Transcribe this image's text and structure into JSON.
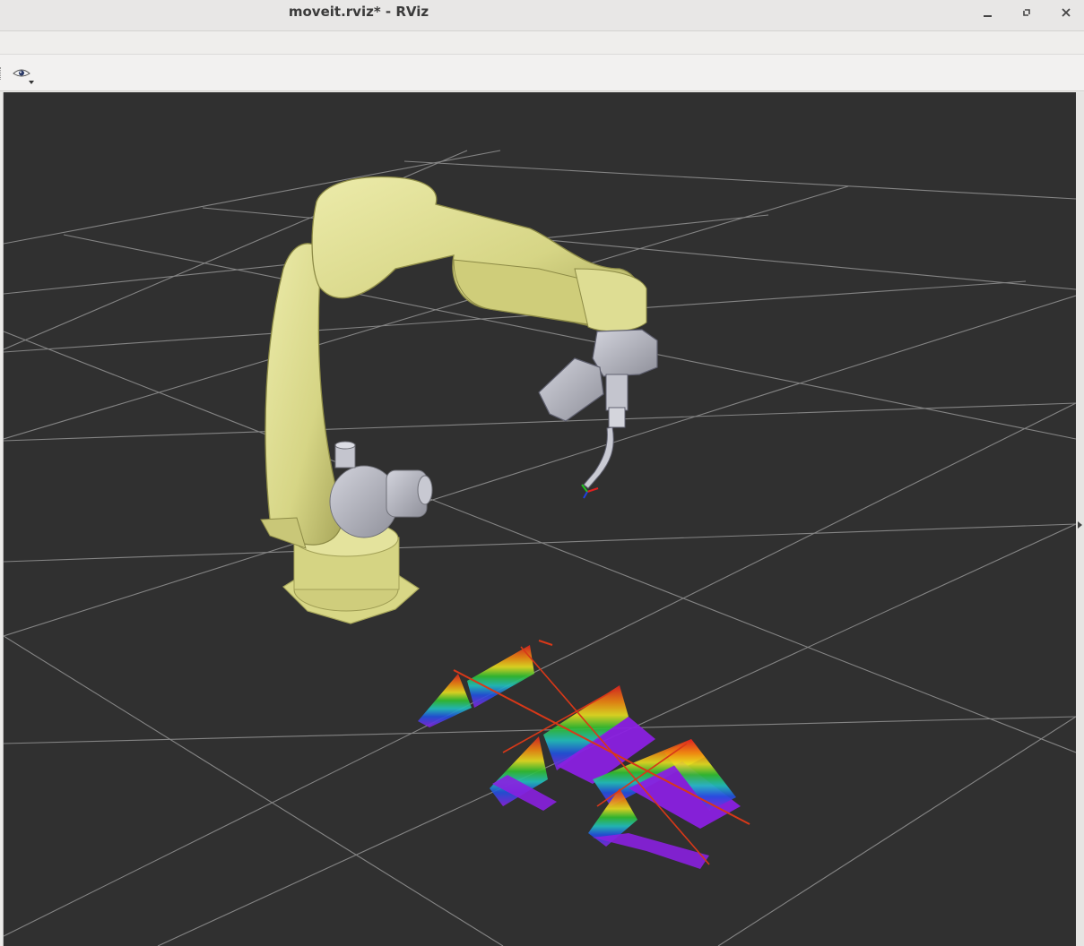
{
  "window": {
    "title": "moveit.rviz* - RViz",
    "controls": [
      "minimize-icon",
      "restore-icon",
      "close-icon"
    ]
  },
  "toolbar": {
    "tools": [
      {
        "icon": "eye-icon",
        "has_dropdown": true
      }
    ]
  },
  "viewport": {
    "background_color": "#303030",
    "grid": true,
    "robot_color": "#dcdb8a",
    "tool_color": "#b6b8c3",
    "pointcloud_color_scheme": "rainbow"
  },
  "colors": {
    "window_bg": "#ecebe9",
    "grid_line": "#9a9a9a"
  }
}
